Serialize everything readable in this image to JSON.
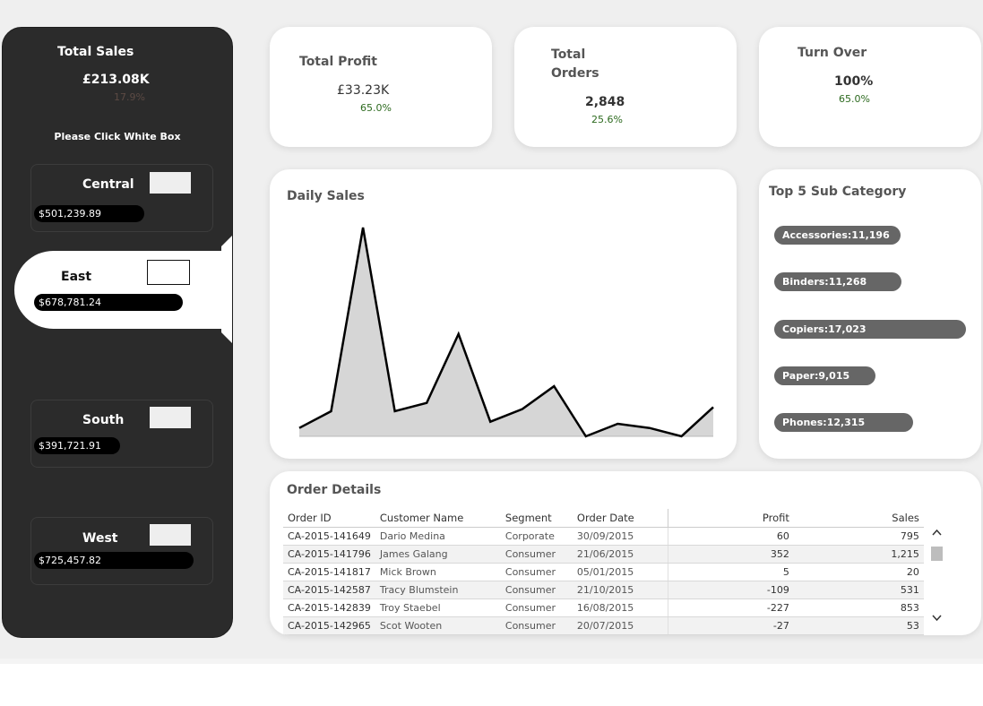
{
  "sidebar": {
    "title": "Total Sales",
    "value": "£213.08K",
    "pct": "17.9%",
    "hint": "Please Click White Box",
    "regions": [
      {
        "name": "Central",
        "sales": "$501,239.89",
        "share": 0.69
      },
      {
        "name": "East",
        "sales": "$678,781.24",
        "share": 0.93,
        "active": true
      },
      {
        "name": "South",
        "sales": "$391,721.91",
        "share": 0.54
      },
      {
        "name": "West",
        "sales": "$725,457.82",
        "share": 1.0
      }
    ]
  },
  "kpis": {
    "profit": {
      "title": "Total Profit",
      "value": "£33.23K",
      "pct": "65.0%"
    },
    "orders": {
      "title_line1": "Total",
      "title_line2": "Orders",
      "value": "2,848",
      "pct": "25.6%"
    },
    "turnover": {
      "title": "Turn Over",
      "value": "100%",
      "pct": "65.0%"
    }
  },
  "daily_sales": {
    "title": "Daily Sales",
    "chart_data": {
      "type": "area",
      "title": "Daily Sales",
      "values": [
        4,
        12,
        100,
        12,
        16,
        49,
        7,
        13,
        24,
        0,
        6,
        4,
        0,
        14
      ],
      "ylim": [
        0,
        100
      ],
      "grid": false,
      "color": "#000000",
      "fill": "#d6d6d6"
    }
  },
  "top5": {
    "title": "Top 5 Sub Category",
    "chart_data": {
      "type": "bar",
      "categories": [
        "Accessories",
        "Binders",
        "Copiers",
        "Paper",
        "Phones"
      ],
      "values": [
        11196,
        11268,
        17023,
        9015,
        12315
      ]
    },
    "labels": [
      "Accessories:11,196",
      "Binders:11,268",
      "Copiers:17,023",
      "Paper:9,015",
      "Phones:12,315"
    ]
  },
  "orders": {
    "title": "Order Details",
    "columns": [
      "Order ID",
      "Customer Name",
      "Segment",
      "Order Date",
      "Profit",
      "Sales"
    ],
    "rows": [
      [
        "CA-2015-141649",
        "Dario Medina",
        "Corporate",
        "30/09/2015",
        "60",
        "795"
      ],
      [
        "CA-2015-141796",
        "James Galang",
        "Consumer",
        "21/06/2015",
        "352",
        "1,215"
      ],
      [
        "CA-2015-141817",
        "Mick Brown",
        "Consumer",
        "05/01/2015",
        "5",
        "20"
      ],
      [
        "CA-2015-142587",
        "Tracy Blumstein",
        "Consumer",
        "21/10/2015",
        "-109",
        "531"
      ],
      [
        "CA-2015-142839",
        "Troy Staebel",
        "Consumer",
        "16/08/2015",
        "-227",
        "853"
      ],
      [
        "CA-2015-142965",
        "Scot Wooten",
        "Consumer",
        "20/07/2015",
        "-27",
        "53"
      ]
    ]
  },
  "colors": {
    "sidebar_bg": "#2b2b2b",
    "canvas_bg": "#efefef",
    "positive": "#2d6a1f",
    "negative": "#c0622b",
    "bar": "#666666"
  }
}
